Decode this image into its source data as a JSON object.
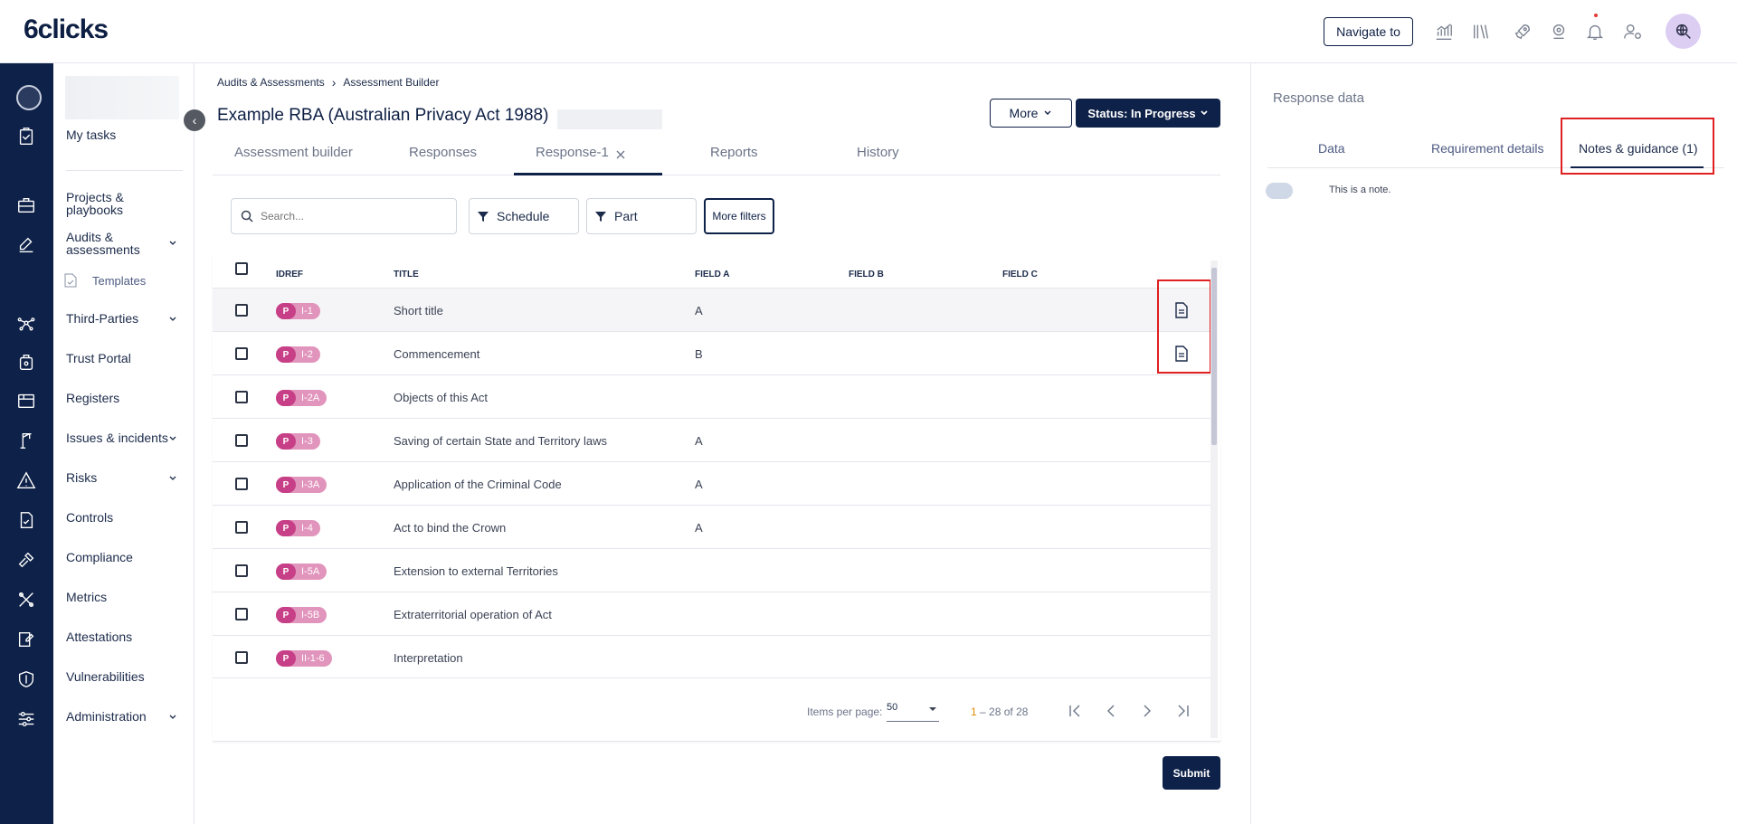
{
  "header": {
    "logo": "6clicks",
    "navigate_to": "Navigate to",
    "icons": [
      "analytics-icon",
      "library-icon",
      "rocket-icon",
      "support-icon",
      "bell-icon",
      "user-settings-icon"
    ],
    "avatar_icon": "search-globe-icon"
  },
  "rail": {
    "icons": [
      "tasks-icon",
      "briefcase-icon",
      "edit-icon",
      "network-icon",
      "portal-icon",
      "register-icon",
      "crane-icon",
      "warning-icon",
      "document-check-icon",
      "hammer-icon",
      "tools-icon",
      "attestation-icon",
      "shield-icon",
      "sliders-icon"
    ]
  },
  "sidebar": {
    "items": [
      {
        "label": "My tasks"
      },
      {
        "label": "Projects & playbooks"
      },
      {
        "label": "Audits & assessments"
      },
      {
        "label": "Templates"
      },
      {
        "label": "Third-Parties"
      },
      {
        "label": "Trust Portal"
      },
      {
        "label": "Registers"
      },
      {
        "label": "Issues & incidents"
      },
      {
        "label": "Risks"
      },
      {
        "label": "Controls"
      },
      {
        "label": "Compliance"
      },
      {
        "label": "Metrics"
      },
      {
        "label": "Attestations"
      },
      {
        "label": "Vulnerabilities"
      },
      {
        "label": "Administration"
      }
    ],
    "collapse_glyph": "‹"
  },
  "breadcrumb": {
    "parent": "Audits & Assessments",
    "separator": "›",
    "current": "Assessment Builder"
  },
  "page": {
    "title": "Example RBA (Australian Privacy Act 1988)",
    "more_label": "More",
    "status_label": "Status: In Progress"
  },
  "tabs": [
    {
      "label": "Assessment builder"
    },
    {
      "label": "Responses"
    },
    {
      "label": "Response-1",
      "active": true
    },
    {
      "label": "Reports"
    },
    {
      "label": "History"
    }
  ],
  "filters": {
    "search_placeholder": "Search...",
    "schedule_label": "Schedule",
    "part_label": "Part",
    "more_filters_label": "More filters"
  },
  "table": {
    "columns": [
      "IDREF",
      "TITLE",
      "FIELD A",
      "FIELD B",
      "FIELD C"
    ],
    "rows": [
      {
        "badge": "P",
        "id": "I-1",
        "title": "Short title",
        "field_a": "A",
        "has_doc": true
      },
      {
        "badge": "P",
        "id": "I-2",
        "title": "Commencement",
        "field_a": "B",
        "has_doc": true
      },
      {
        "badge": "P",
        "id": "I-2A",
        "title": "Objects of this Act",
        "field_a": "",
        "has_doc": false
      },
      {
        "badge": "P",
        "id": "I-3",
        "title": "Saving of certain State and Territory laws",
        "field_a": "A",
        "has_doc": false
      },
      {
        "badge": "P",
        "id": "I-3A",
        "title": "Application of the Criminal Code",
        "field_a": "A",
        "has_doc": false
      },
      {
        "badge": "P",
        "id": "I-4",
        "title": "Act to bind the Crown",
        "field_a": "A",
        "has_doc": false
      },
      {
        "badge": "P",
        "id": "I-5A",
        "title": "Extension to external Territories",
        "field_a": "",
        "has_doc": false
      },
      {
        "badge": "P",
        "id": "I-5B",
        "title": "Extraterritorial operation of Act",
        "field_a": "",
        "has_doc": false
      },
      {
        "badge": "P",
        "id": "II-1-6",
        "title": "Interpretation",
        "field_a": "",
        "has_doc": false
      }
    ]
  },
  "pagination": {
    "items_per_page_label": "Items per page:",
    "items_per_page": "50",
    "range_start": "1",
    "range_rest": "– 28 of 28"
  },
  "submit_label": "Submit",
  "right_panel": {
    "title": "Response data",
    "tabs": [
      {
        "label": "Data"
      },
      {
        "label": "Requirement details"
      },
      {
        "label": "Notes & guidance (1)",
        "active": true
      }
    ],
    "note_text": "This is a note."
  },
  "colors": {
    "navy": "#0e2148",
    "badge_dark": "#c73f86",
    "badge_light": "#e194bc",
    "highlight_red": "#e02020",
    "range_start_orange": "#e08a00"
  }
}
